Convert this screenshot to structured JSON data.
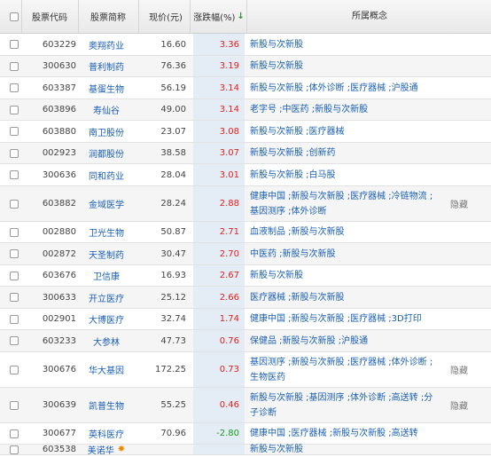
{
  "columns": {
    "code": "股票代码",
    "name": "股票简称",
    "price": "现价(元)",
    "change": "涨跌幅(%)",
    "sort_icon": "↓",
    "concept": "所属概念"
  },
  "colors": {
    "up": "#e0211b",
    "down": "#1e9a1e",
    "link": "#1a5fb4",
    "sort_bg": "#e4ecf5"
  },
  "rows": [
    {
      "code": "603229",
      "name": "奥翔药业",
      "price": "16.60",
      "change": "3.36",
      "concept": "新股与次新股",
      "extra": ""
    },
    {
      "code": "300630",
      "name": "普利制药",
      "price": "76.36",
      "change": "3.19",
      "concept": "新股与次新股",
      "extra": ""
    },
    {
      "code": "603387",
      "name": "基蛋生物",
      "price": "56.19",
      "change": "3.14",
      "concept": "新股与次新股 ;体外诊断 ;医疗器械 ;沪股通",
      "extra": ""
    },
    {
      "code": "603896",
      "name": "寿仙谷",
      "price": "49.00",
      "change": "3.14",
      "concept": "老字号 ;中医药 ;新股与次新股",
      "extra": ""
    },
    {
      "code": "603880",
      "name": "南卫股份",
      "price": "23.07",
      "change": "3.08",
      "concept": "新股与次新股 ;医疗器械",
      "extra": ""
    },
    {
      "code": "002923",
      "name": "润都股份",
      "price": "38.58",
      "change": "3.07",
      "concept": "新股与次新股 ;创新药",
      "extra": ""
    },
    {
      "code": "300636",
      "name": "同和药业",
      "price": "28.04",
      "change": "3.01",
      "concept": "新股与次新股 ;白马股",
      "extra": ""
    },
    {
      "code": "603882",
      "name": "金域医学",
      "price": "28.24",
      "change": "2.88",
      "concept": "健康中国 ;新股与次新股 ;医疗器械 ;冷链物流 ;基因测序 ;体外诊断",
      "extra": "隐藏"
    },
    {
      "code": "002880",
      "name": "卫光生物",
      "price": "50.87",
      "change": "2.71",
      "concept": "血液制品 ;新股与次新股",
      "extra": ""
    },
    {
      "code": "002872",
      "name": "天圣制药",
      "price": "30.47",
      "change": "2.70",
      "concept": "中医药 ;新股与次新股",
      "extra": ""
    },
    {
      "code": "603676",
      "name": "卫信康",
      "price": "16.93",
      "change": "2.67",
      "concept": "新股与次新股",
      "extra": ""
    },
    {
      "code": "300633",
      "name": "开立医疗",
      "price": "25.12",
      "change": "2.66",
      "concept": "医疗器械 ;新股与次新股",
      "extra": ""
    },
    {
      "code": "002901",
      "name": "大博医疗",
      "price": "32.74",
      "change": "1.74",
      "concept": "健康中国 ;新股与次新股 ;医疗器械 ;3D打印",
      "extra": ""
    },
    {
      "code": "603233",
      "name": "大参林",
      "price": "47.73",
      "change": "0.76",
      "concept": "保健品 ;新股与次新股 ;沪股通",
      "extra": ""
    },
    {
      "code": "300676",
      "name": "华大基因",
      "price": "172.25",
      "change": "0.73",
      "concept": "基因测序 ;新股与次新股 ;医疗器械 ;体外诊断 ;生物医药",
      "extra": "隐藏"
    },
    {
      "code": "300639",
      "name": "凯普生物",
      "price": "55.25",
      "change": "0.46",
      "concept": "新股与次新股 ;基因测序 ;体外诊断 ;高送转 ;分子诊断",
      "extra": "隐藏"
    },
    {
      "code": "300677",
      "name": "英科医疗",
      "price": "70.96",
      "change": "-2.80",
      "concept": "健康中国 ;医疗器械 ;新股与次新股 ;高送转",
      "extra": ""
    },
    {
      "code": "603538",
      "name": "美诺华",
      "price": "",
      "change": "",
      "concept": "新股与次新股",
      "extra": ""
    }
  ]
}
